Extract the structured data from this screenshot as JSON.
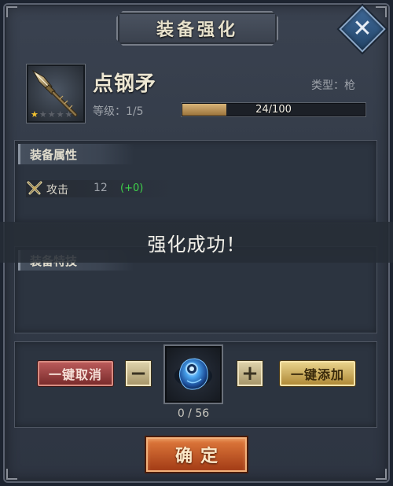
{
  "dialog": {
    "title": "装备强化",
    "close_symbol": "✕"
  },
  "item": {
    "name": "点钢矛",
    "type_text": "类型：枪",
    "level_text": "等级：1/5",
    "stars": {
      "filled": 1,
      "total": 5
    },
    "icon": "spear-icon",
    "exp": {
      "current": 24,
      "max": 100,
      "text": "24/100"
    }
  },
  "attributes": {
    "heading": "装备属性",
    "rows": [
      {
        "label": "攻击",
        "value": "12",
        "delta": "(+0)",
        "icon": "crossed-swords-icon"
      }
    ]
  },
  "skills": {
    "heading": "装备特技"
  },
  "toast": {
    "message": "强化成功！"
  },
  "materials": {
    "cancel_label": "一键取消",
    "add_label": "一键添加",
    "minus_symbol": "−",
    "plus_symbol": "+",
    "material_icon": "blue-gem-icon",
    "count_text": "0 / 56"
  },
  "confirm": {
    "label": "确定"
  },
  "colors": {
    "panel_bg": "#2c3440",
    "exp_fill": "#c9a465",
    "delta_green": "#3fd24a",
    "cancel_red": "#9a4040",
    "add_gold": "#d4b462",
    "confirm_orange": "#c85a26"
  }
}
